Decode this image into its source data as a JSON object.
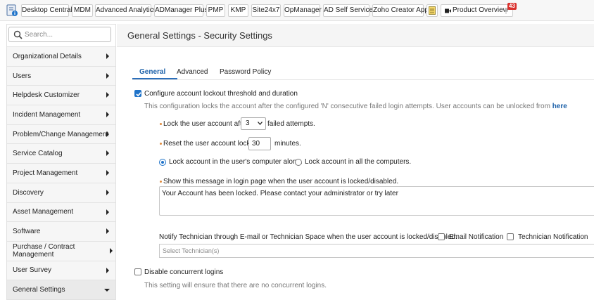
{
  "topbar": {
    "items": [
      {
        "label": "Desktop Central"
      },
      {
        "label": "MDM"
      },
      {
        "label": "Advanced Analytics"
      },
      {
        "label": "ADManager Plus"
      },
      {
        "label": "PMP"
      },
      {
        "label": "KMP"
      },
      {
        "label": "Site24x7"
      },
      {
        "label": "OpManager"
      },
      {
        "label": "AD Self Service"
      },
      {
        "label": "Zoho Creator App"
      }
    ],
    "product_overview_label": "Product Overview",
    "badge_count": "43"
  },
  "sidebar": {
    "search_placeholder": "Search...",
    "items": [
      {
        "label": "Organizational Details"
      },
      {
        "label": "Users"
      },
      {
        "label": "Helpdesk Customizer"
      },
      {
        "label": "Incident Management"
      },
      {
        "label": "Problem/Change Management"
      },
      {
        "label": "Service Catalog"
      },
      {
        "label": "Project Management"
      },
      {
        "label": "Discovery"
      },
      {
        "label": "Asset Management"
      },
      {
        "label": "Software"
      },
      {
        "label": "Purchase / Contract Management"
      },
      {
        "label": "User Survey"
      },
      {
        "label": "General Settings"
      }
    ]
  },
  "main": {
    "title": "General Settings - Security Settings",
    "tabs": [
      {
        "label": "General"
      },
      {
        "label": "Advanced"
      },
      {
        "label": "Password Policy"
      }
    ],
    "lockout": {
      "label": "Configure account lockout threshold and duration",
      "checked": true,
      "help_text": "This configuration locks the account after the configured 'N' consecutive failed login attempts. User accounts can be unlocked from",
      "help_link": "here",
      "lock_prefix": "Lock the user account after",
      "lock_value": "3",
      "lock_suffix": "failed attempts.",
      "reset_prefix": "Reset the user account lock in",
      "reset_value": "30",
      "reset_suffix": "minutes.",
      "radio_computer": "Lock account in the user's computer alone.",
      "radio_all": "Lock account in all the computers.",
      "message_label": "Show this message in login page when the user account is locked/disabled.",
      "message_value": "Your Account has been locked. Please contact your administrator or try later",
      "notify_label": "Notify Technician through E-mail or Technician Space when the user account is locked/disabled.",
      "email_notification": "Email Notification",
      "technician_notification": "Technician Notification",
      "technician_placeholder": "Select Technician(s)"
    },
    "concurrent": {
      "label": "Disable concurrent logins",
      "help_text": "This setting will ensure that there are no concurrent logins."
    }
  },
  "colors": {
    "accent": "#1f73c9",
    "link": "#1a5fa8",
    "badge": "#d9302c",
    "required_dot": "#e08a3c"
  }
}
